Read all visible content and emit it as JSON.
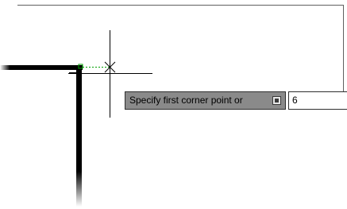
{
  "dynamic_input": {
    "prompt_label": "Specify first corner point or",
    "options_icon": "down-arrow-icon",
    "value": "6"
  },
  "colors": {
    "background": "#ffffff",
    "geometry": "#000000",
    "tracking_line": "#00a000",
    "tooltip_bg": "#8a8a8a"
  }
}
